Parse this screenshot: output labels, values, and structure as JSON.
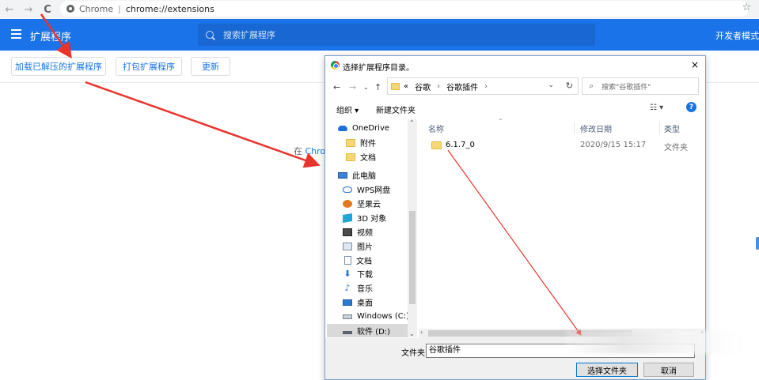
{
  "browser": {
    "tab_site": "Chrome",
    "url": "chrome://extensions",
    "back_icon": "←",
    "forward_icon": "→",
    "reload_icon": "C",
    "star_icon": "☆"
  },
  "header": {
    "title": "扩展程序",
    "search_placeholder": "搜索扩展程序",
    "dev_mode_label": "开发者模式",
    "accent_color": "#1a73e8"
  },
  "toolbar": {
    "load_unpacked": "加载已解压的扩展程序",
    "pack": "打包扩展程序",
    "update": "更新"
  },
  "behind_text": {
    "prefix": "在",
    "link": "Chro"
  },
  "dialog": {
    "title": "选择扩展程序目录。",
    "close_icon": "×",
    "address": {
      "overflow": "«",
      "segments": [
        "谷歌",
        "谷歌插件"
      ],
      "separator": "›",
      "dropdown_icon": "⌄",
      "refresh_icon": "↻"
    },
    "search_placeholder": "搜索\"谷歌插件\"",
    "search_icon": "⌕",
    "organize": "组织 ▾",
    "new_folder": "新建文件夹",
    "view_icon": "☷ ▾",
    "help_icon": "?",
    "nav_items": [
      {
        "label": "OneDrive",
        "icon": "cloud-icon"
      },
      {
        "label": "附件",
        "icon": "folder-icon"
      },
      {
        "label": "文档",
        "icon": "folder-icon"
      },
      {
        "label": "此电脑",
        "icon": "pc-icon"
      },
      {
        "label": "WPS网盘",
        "icon": "wps-cloud-icon"
      },
      {
        "label": "坚果云",
        "icon": "nut-cloud-icon"
      },
      {
        "label": "3D 对象",
        "icon": "3d-objects-icon"
      },
      {
        "label": "视频",
        "icon": "video-icon"
      },
      {
        "label": "图片",
        "icon": "picture-icon"
      },
      {
        "label": "文档",
        "icon": "document-icon"
      },
      {
        "label": "下载",
        "icon": "download-icon"
      },
      {
        "label": "音乐",
        "icon": "music-icon"
      },
      {
        "label": "桌面",
        "icon": "desktop-icon"
      },
      {
        "label": "Windows (C:)",
        "icon": "drive-c-icon"
      },
      {
        "label": "软件 (D:)",
        "icon": "drive-d-icon"
      }
    ],
    "columns": {
      "name": "名称",
      "modified": "修改日期",
      "type": "类型"
    },
    "files": [
      {
        "name": "6.1.7_0",
        "modified": "2020/9/15 15:17",
        "type": "文件夹"
      }
    ],
    "folder_label": "文件夹:",
    "folder_value": "谷歌插件",
    "select_button": "选择文件夹",
    "cancel_button": "取消"
  },
  "annotation_color": "#e8342c"
}
